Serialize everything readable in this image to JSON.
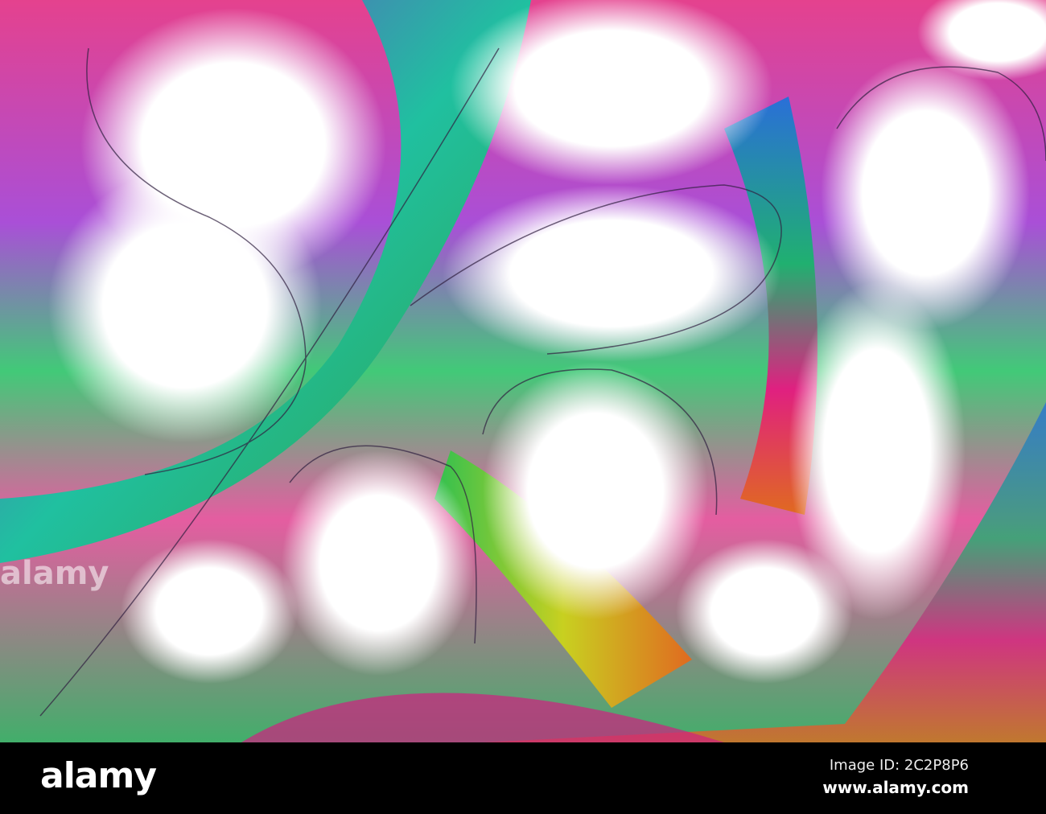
{
  "photo": {
    "subject": "abstract rainbow paper ribbons",
    "watermark_text": "alamy",
    "colors": [
      "#e0207a",
      "#1fbf50",
      "#7a2fd0",
      "#e06a20",
      "#2a6fd8",
      "#c8d020"
    ]
  },
  "footer": {
    "logo": "alamy",
    "image_id": "Image ID: 2C2P8P6",
    "website": "www.alamy.com"
  }
}
